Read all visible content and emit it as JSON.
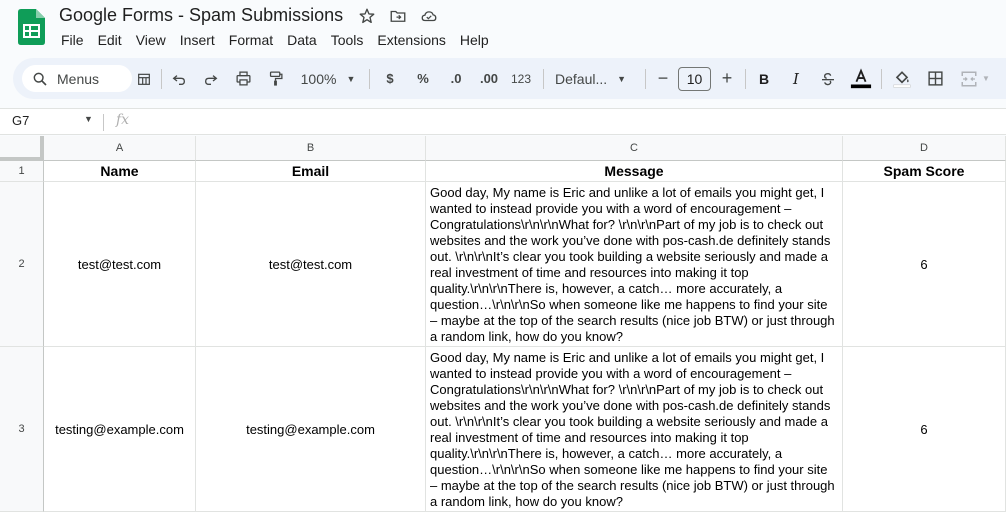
{
  "window": {
    "title": "Google Forms - Spam Submissions"
  },
  "menu": [
    "File",
    "Edit",
    "View",
    "Insert",
    "Format",
    "Data",
    "Tools",
    "Extensions",
    "Help"
  ],
  "toolbar": {
    "search_label": "Menus",
    "zoom": "100%",
    "currency_label": "$",
    "percent_label": "%",
    "decrease_decimal_label": ".0",
    "increase_decimal_label": ".00",
    "number_format_label": "123",
    "font_name": "Defaul...",
    "font_size": "10",
    "text_color": "#000000",
    "icons": [
      "undo-icon",
      "redo-icon",
      "print-icon",
      "paint-format-icon",
      "bold-icon",
      "italic-icon",
      "strikethrough-icon",
      "text-color-icon",
      "fill-color-icon",
      "borders-icon",
      "merge-cells-icon"
    ]
  },
  "formula_bar": {
    "cell_ref": "G7",
    "fx_label": "fx",
    "value": ""
  },
  "columns": [
    "A",
    "B",
    "C",
    "D"
  ],
  "rows": [
    "1",
    "2",
    "3"
  ],
  "sheet": {
    "header": [
      "Name",
      "Email",
      "Message",
      "Spam Score"
    ],
    "records": [
      {
        "name": "test@test.com",
        "email": "test@test.com",
        "message": "Good day, My name is Eric and unlike a lot of emails you might get, I wanted to instead provide you with a word of encouragement – Congratulations\\r\\n\\r\\nWhat for? \\r\\n\\r\\nPart of my job is to check out websites and the work you’ve done with pos-cash.de definitely stands out. \\r\\n\\r\\nIt’s clear you took building a website seriously and made a real investment of time and resources into making it top quality.\\r\\n\\r\\nThere is, however, a catch… more accurately, a question…\\r\\n\\r\\nSo when someone like me happens to find your site – maybe at the top of the search results (nice job BTW) or just through a random link, how do you know?",
        "spam_score": "6"
      },
      {
        "name": "testing@example.com",
        "email": "testing@example.com",
        "message": "Good day, My name is Eric and unlike a lot of emails you might get, I wanted to instead provide you with a word of encouragement – Congratulations\\r\\n\\r\\nWhat for? \\r\\n\\r\\nPart of my job is to check out websites and the work you’ve done with pos-cash.de definitely stands out. \\r\\n\\r\\nIt’s clear you took building a website seriously and made a real investment of time and resources into making it top quality.\\r\\n\\r\\nThere is, however, a catch… more accurately, a question…\\r\\n\\r\\nSo when someone like me happens to find your site – maybe at the top of the search results (nice job BTW) or just through a random link, how do you know?",
        "spam_score": "6"
      }
    ]
  },
  "colors": {
    "accent": "#0b57d0",
    "sheets_green": "#0f9d58",
    "toolbar_bg": "#edf2fa",
    "header_bg": "#f8f9fa",
    "grid_line": "#e1e3e1"
  }
}
